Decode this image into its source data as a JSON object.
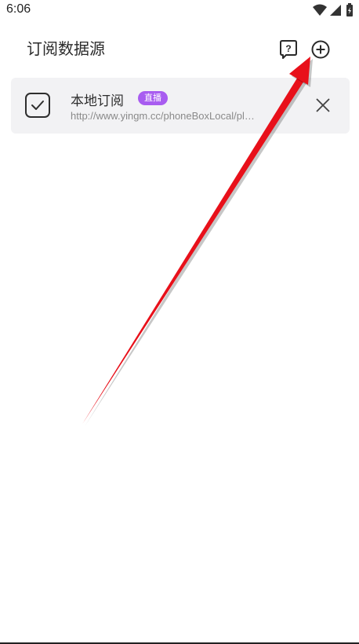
{
  "status_bar": {
    "time": "6:06",
    "icons": [
      "wifi-icon",
      "signal-icon",
      "battery-icon"
    ]
  },
  "header": {
    "title": "订阅数据源",
    "help_icon": "help-icon",
    "add_icon": "add-icon"
  },
  "subscriptions": [
    {
      "checked": true,
      "title": "本地订阅",
      "badge": "直播",
      "url": "http://www.yingm.cc/phoneBoxLocal/pl…",
      "close_icon": "close-icon"
    }
  ],
  "colors": {
    "badge": "#a85cf0",
    "card_background": "#f2f2f4",
    "arrow": "#e8101a"
  }
}
